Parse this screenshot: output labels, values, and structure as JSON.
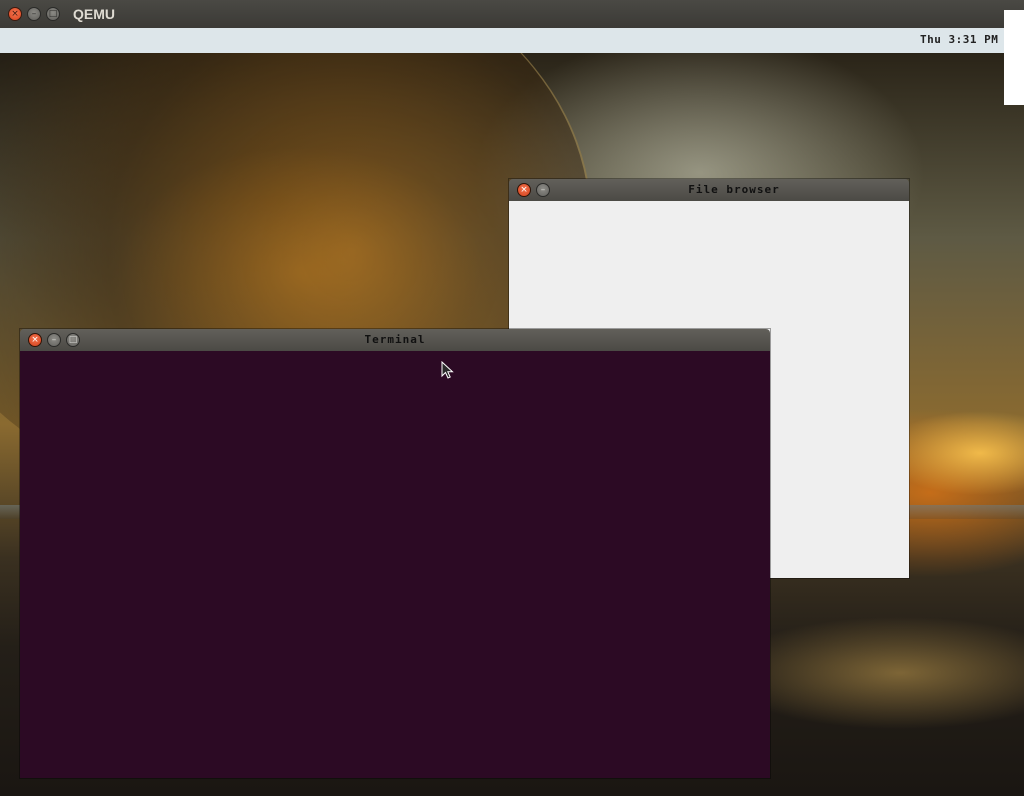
{
  "host": {
    "title": "QEMU",
    "buttons": {
      "close": "×",
      "minimize": "–",
      "maximize": "□"
    }
  },
  "panel": {
    "clock": "Thu 3:31 PM"
  },
  "windows": {
    "file_browser": {
      "title": "File browser",
      "buttons": {
        "close": "×",
        "minimize": "–"
      }
    },
    "terminal": {
      "title": "Terminal",
      "buttons": {
        "close": "×",
        "minimize": "–",
        "maximize": "□"
      },
      "background": "#2c0a24"
    }
  },
  "colors": {
    "close_button": "#e0522a",
    "panel": "#dde6ea",
    "file_browser_bg": "#efefef",
    "terminal_bg": "#2c0a24"
  }
}
